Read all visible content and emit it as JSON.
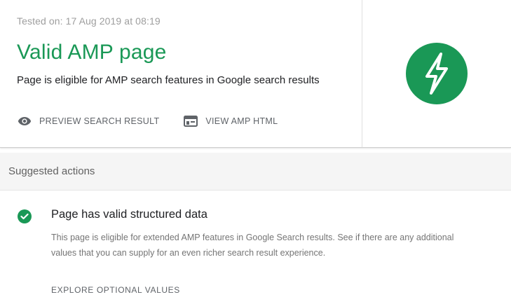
{
  "result": {
    "tested_on": "Tested on: 17 Aug 2019 at 08:19",
    "title": "Valid AMP page",
    "subtitle": "Page is eligible for AMP search features in Google search results",
    "actions": [
      {
        "label": "PREVIEW SEARCH RESULT",
        "icon": "eye-icon"
      },
      {
        "label": "VIEW AMP HTML",
        "icon": "web-page-icon"
      }
    ],
    "badge_icon": "amp-lightning-icon"
  },
  "suggested": {
    "header": "Suggested actions",
    "items": [
      {
        "icon": "check-circle-icon",
        "title": "Page has valid structured data",
        "description": "This page is eligible for extended AMP features in Google Search results. See if there are any additional values that you can supply for an even richer search result experience.",
        "link": "EXPLORE OPTIONAL VALUES"
      }
    ]
  },
  "colors": {
    "success_green": "#1a9856",
    "muted_text": "#9e9e9e",
    "section_bg": "#f5f5f5"
  }
}
